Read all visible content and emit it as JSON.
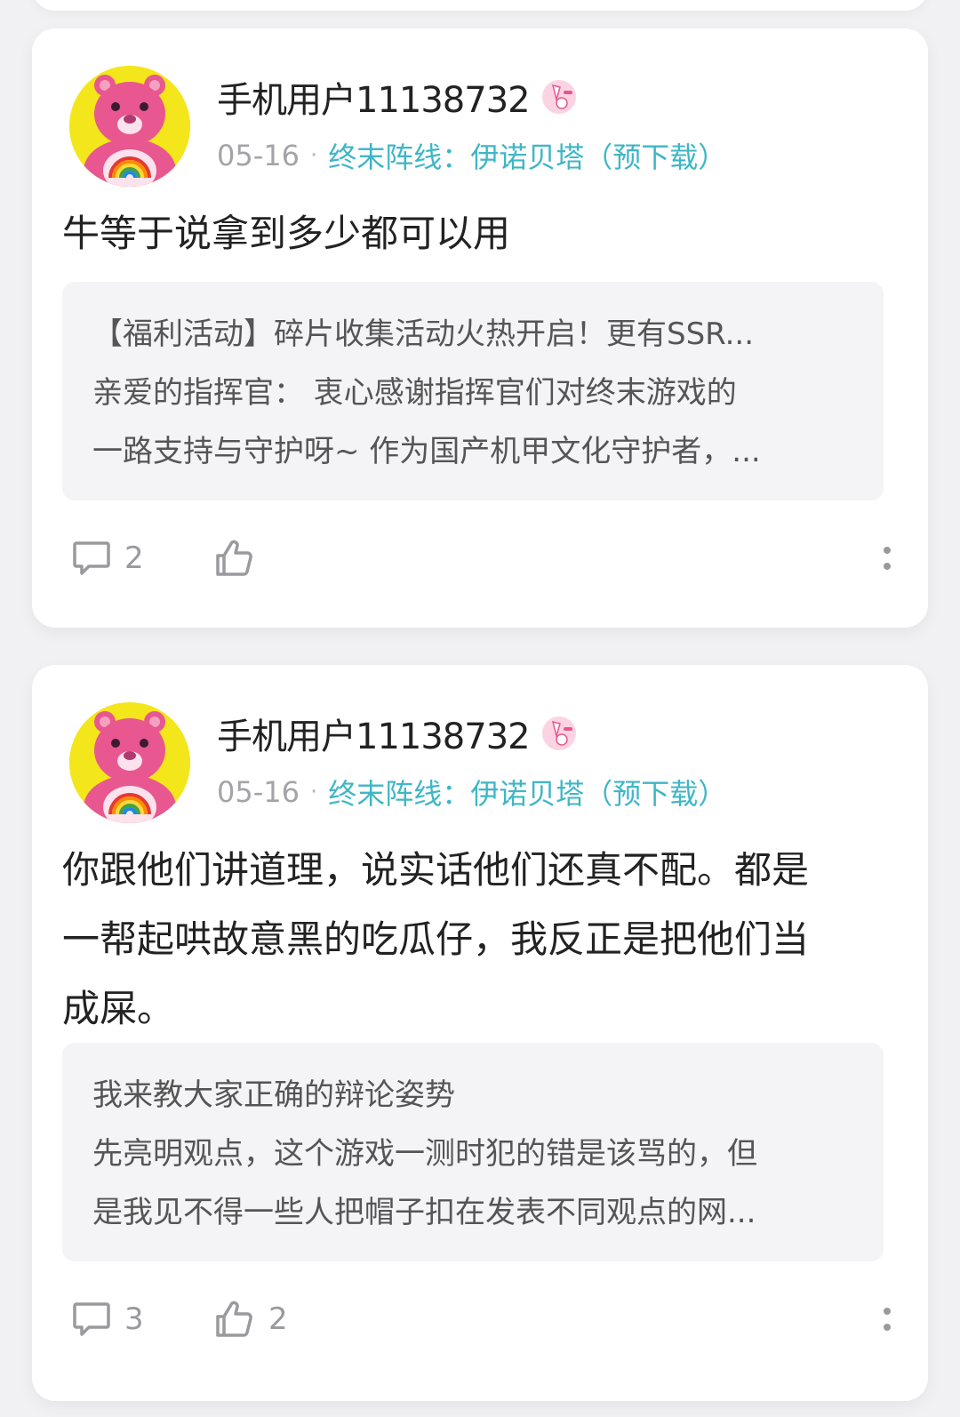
{
  "posts": [
    {
      "username": "手机用户11138732",
      "badge_icon": "bunny-badge-icon",
      "date": "05-16",
      "separator": "·",
      "game": "终末阵线：伊诺贝塔（预下载）",
      "content_lines": [
        "牛等于说拿到多少都可以用"
      ],
      "quote_lines": [
        "【福利活动】碎片收集活动火热开启！更有SSR...",
        "亲爱的指挥官：   衷心感谢指挥官们对终末游戏的",
        "一路支持与守护呀~  作为国产机甲文化守护者，..."
      ],
      "comment_count": "2",
      "like_count": ""
    },
    {
      "username": "手机用户11138732",
      "badge_icon": "bunny-badge-icon",
      "date": "05-16",
      "separator": "·",
      "game": "终末阵线：伊诺贝塔（预下载）",
      "content_lines": [
        "你跟他们讲道理，说实话他们还真不配。都是",
        "一帮起哄故意黑的吃瓜仔，我反正是把他们当",
        "成屎。"
      ],
      "quote_lines": [
        "我来教大家正确的辩论姿势",
        "先亮明观点，这个游戏一测时犯的错是该骂的，但",
        "是我见不得一些人把帽子扣在发表不同观点的网..."
      ],
      "comment_count": "3",
      "like_count": "2"
    }
  ],
  "colors": {
    "background": "#f1f1f3",
    "card": "#ffffff",
    "link": "#3fb6c6",
    "muted": "#a4a4a8",
    "quote_bg": "#f4f4f6",
    "avatar_bg": "#f3e61a",
    "bear_pink": "#e8578f"
  }
}
